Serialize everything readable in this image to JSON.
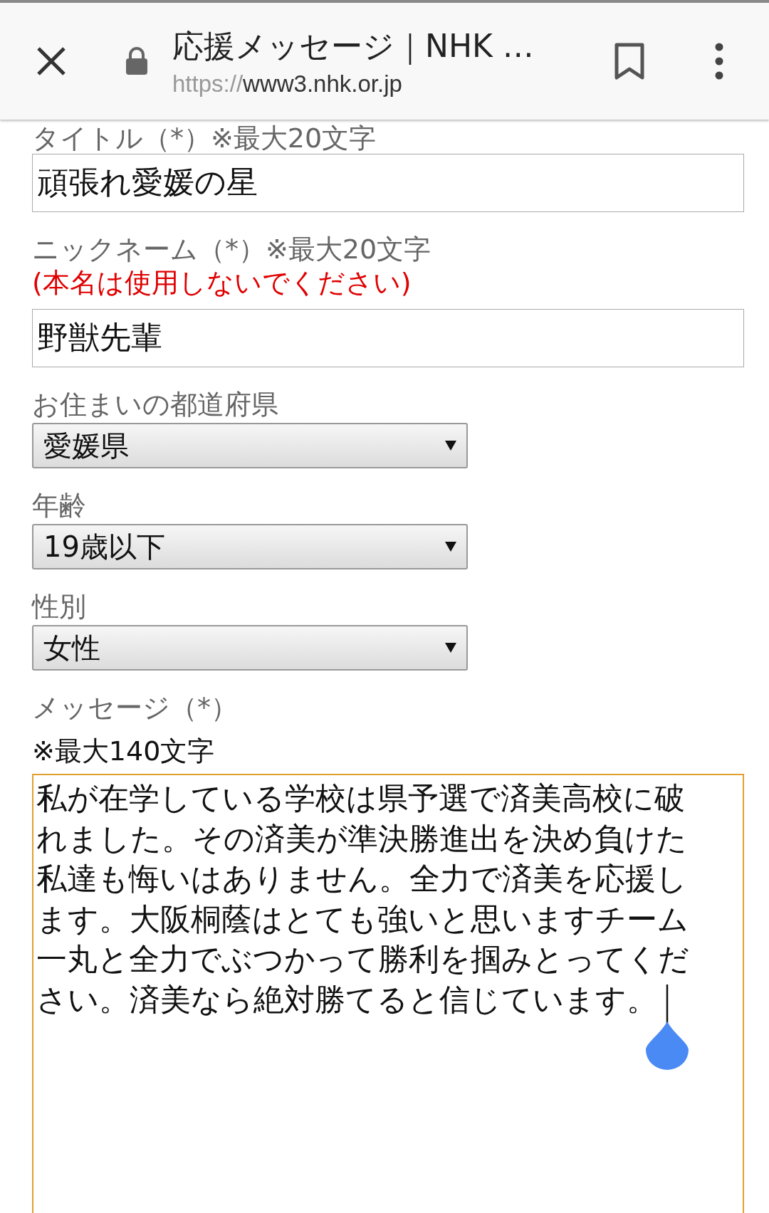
{
  "toolbar": {
    "title": "応援メッセージ｜NHK …",
    "url_scheme": "https://",
    "url_host": "www3.nhk.or.jp"
  },
  "form": {
    "title_label": "タイトル（*）※最大20文字",
    "title_value": "頑張れ愛媛の星",
    "nickname_label": "ニックネーム（*）※最大20文字",
    "nickname_note": "(本名は使用しないでください)",
    "nickname_value": "野獣先輩",
    "selects": [
      {
        "label": "お住まいの都道府県",
        "value": "愛媛県"
      },
      {
        "label": "年齢",
        "value": "19歳以下"
      },
      {
        "label": "性別",
        "value": "女性"
      }
    ],
    "message_label": "メッセージ（*）",
    "message_limit": "※最大140文字",
    "message_value": "私が在学している学校は県予選で済美高校に破れました。その済美が準決勝進出を決め負けた私達も悔いはありません。全力で済美を応援します。大阪桐蔭はとても強いと思いますチーム一丸と全力でぶつかって勝利を掴みとってください。済美なら絶対勝てると信じています。",
    "message_focused": true
  }
}
